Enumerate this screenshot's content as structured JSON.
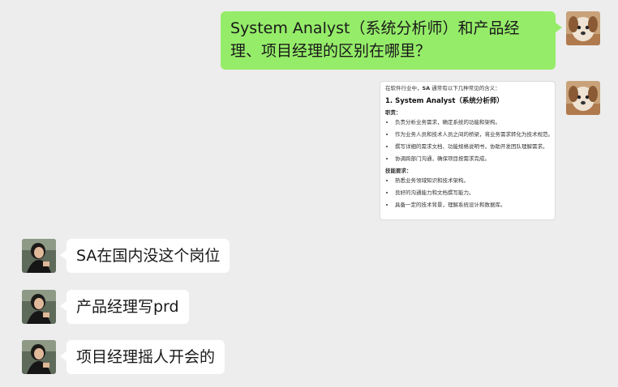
{
  "messages": {
    "m1": {
      "text": "System Analyst（系统分析师）和产品经理、项目经理的区别在哪里？"
    },
    "m2": {
      "intro_prefix": "在软件行业中，",
      "intro_bold": "SA",
      "intro_suffix": " 通常有以下几种常见的含义：",
      "heading": "1. System Analyst（系统分析师）",
      "duties_label": "职责：",
      "duties": [
        "负责分析业务需求，确定系统的功能和架构。",
        "作为业务人员和技术人员之间的桥梁，将业务需求转化为技术规范。",
        "撰写详细的需求文档、功能规格说明书，协助开发团队理解需求。",
        "协调跨部门沟通，确保项目按需求完成。"
      ],
      "skills_label": "技能要求：",
      "skills": [
        "熟悉业务领域知识和技术架构。",
        "良好的沟通能力和文档撰写能力。",
        "具备一定的技术背景，理解系统设计和数据库。"
      ]
    },
    "m3": {
      "text": "SA在国内没这个岗位"
    },
    "m4": {
      "text": "产品经理写prd"
    },
    "m5": {
      "text": "项目经理摇人开会的"
    }
  },
  "icons": {
    "self_avatar": "dog-avatar-icon",
    "other_avatar": "woman-avatar-icon"
  },
  "colors": {
    "background": "#ededed",
    "self_bubble": "#95ec69",
    "other_bubble": "#ffffff"
  }
}
